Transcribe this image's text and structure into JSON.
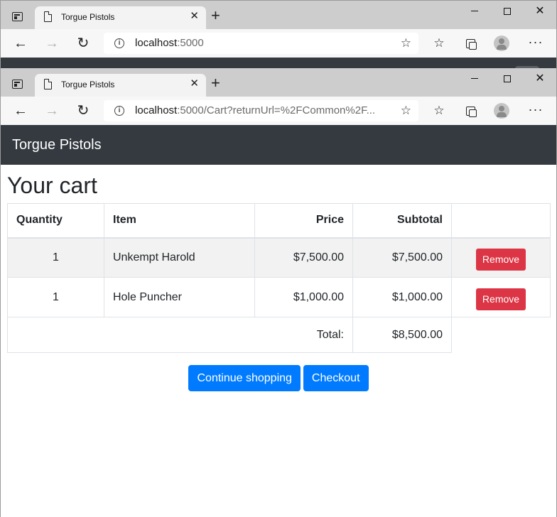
{
  "browser": {
    "tab_title": "Torgue Pistols",
    "tab_close": "✕",
    "new_tab": "+",
    "back_window_url": {
      "host": "localhost",
      "rest": ":5000"
    },
    "front_window_url": {
      "host": "localhost",
      "rest": ":5000/Cart?returnUrl=%2FCommon%2F..."
    },
    "caption": {
      "close": "✕"
    }
  },
  "icons": {
    "back": "back-arrow-icon",
    "forward": "forward-arrow-icon",
    "reload": "reload-icon",
    "info": "info-icon",
    "favorite": "add-favorite-icon",
    "favorites": "favorites-icon",
    "collections": "collections-icon",
    "profile": "profile-icon",
    "more": "more-icon"
  },
  "navbar": {
    "brand": "Torgue Pistols"
  },
  "page": {
    "title": "Your cart"
  },
  "cart": {
    "headers": {
      "quantity": "Quantity",
      "item": "Item",
      "price": "Price",
      "subtotal": "Subtotal"
    },
    "rows": [
      {
        "quantity": "1",
        "item": "Unkempt Harold",
        "price": "$7,500.00",
        "subtotal": "$7,500.00",
        "action": "Remove"
      },
      {
        "quantity": "1",
        "item": "Hole Puncher",
        "price": "$1,000.00",
        "subtotal": "$1,000.00",
        "action": "Remove"
      }
    ],
    "total_label": "Total:",
    "total_value": "$8,500.00"
  },
  "buttons": {
    "continue_shopping": "Continue shopping",
    "checkout": "Checkout"
  },
  "colors": {
    "navbar": "#343a40",
    "primary": "#007bff",
    "danger": "#dc3545"
  }
}
